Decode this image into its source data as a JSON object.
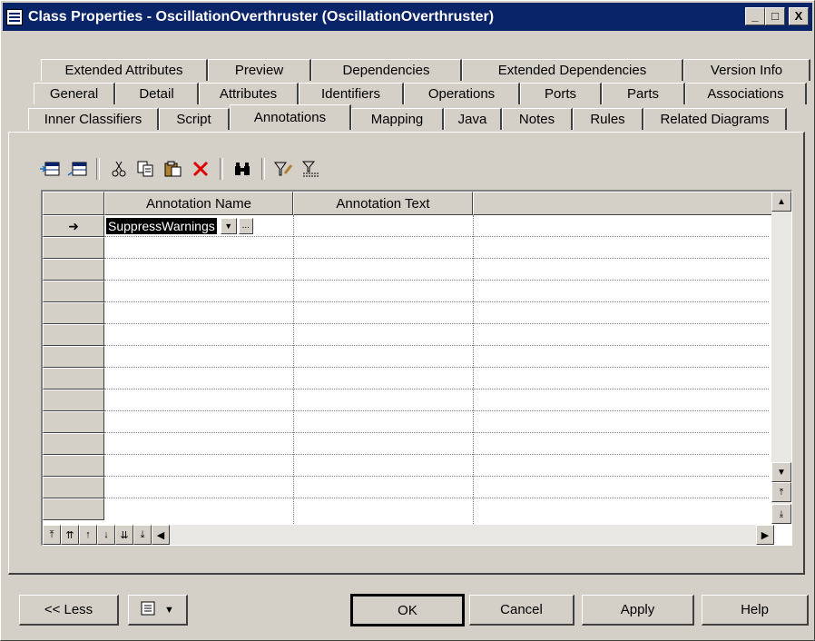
{
  "window": {
    "title": "Class Properties - OscillationOverthruster (OscillationOverthruster)",
    "minimize_label": "_",
    "maximize_label": "□",
    "close_label": "X"
  },
  "tabs": {
    "row1": [
      "Extended Attributes",
      "Preview",
      "Dependencies",
      "Extended Dependencies",
      "Version Info"
    ],
    "row2": [
      "General",
      "Detail",
      "Attributes",
      "Identifiers",
      "Operations",
      "Ports",
      "Parts",
      "Associations"
    ],
    "row3": [
      "Inner Classifiers",
      "Script",
      "Annotations",
      "Mapping",
      "Java",
      "Notes",
      "Rules",
      "Related Diagrams"
    ],
    "active": "Annotations"
  },
  "toolbar": {
    "icons": [
      "insert-row-icon",
      "add-row-icon",
      "cut-icon",
      "copy-icon",
      "paste-icon",
      "delete-icon",
      "find-icon",
      "filter-icon",
      "filter-clear-icon"
    ]
  },
  "grid": {
    "columns": [
      "Annotation Name",
      "Annotation Text"
    ],
    "current_row_marker": "➜",
    "rows": [
      {
        "name": "SuppressWarnings",
        "text": ""
      }
    ],
    "editor_ellipsis": "..."
  },
  "buttons": {
    "less": "<< Less",
    "ok": "OK",
    "cancel": "Cancel",
    "apply": "Apply",
    "help": "Help"
  }
}
